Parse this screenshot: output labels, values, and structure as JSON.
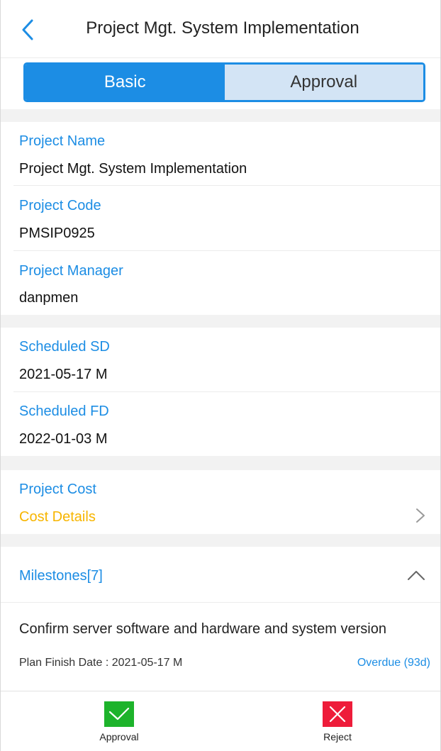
{
  "header": {
    "title": "Project Mgt. System Implementation",
    "back_icon": "chevron-left-icon"
  },
  "tabs": [
    {
      "label": "Basic",
      "active": true
    },
    {
      "label": "Approval",
      "active": false
    }
  ],
  "fields": {
    "project_name": {
      "label": "Project Name",
      "value": "Project Mgt. System Implementation"
    },
    "project_code": {
      "label": "Project Code",
      "value": "PMSIP0925"
    },
    "project_manager": {
      "label": "Project Manager",
      "value": "danpmen"
    },
    "scheduled_sd": {
      "label": "Scheduled SD",
      "value": "2021-05-17 M"
    },
    "scheduled_fd": {
      "label": "Scheduled FD",
      "value": "2022-01-03 M"
    },
    "project_cost": {
      "label": "Project Cost",
      "link": "Cost Details"
    }
  },
  "milestones": {
    "title": "Milestones[7]",
    "items": [
      {
        "description": "Confirm server software and hardware and system version",
        "plan_finish": "Plan Finish Date : 2021-05-17 M",
        "status": "Overdue (93d)"
      }
    ]
  },
  "actions": {
    "approval": {
      "label": "Approval",
      "color": "#1db32b"
    },
    "reject": {
      "label": "Reject",
      "color": "#ee1c3a"
    }
  },
  "colors": {
    "accent": "#1c8de4",
    "link_yellow": "#f7b500",
    "tab_inactive": "#d3e4f5"
  }
}
